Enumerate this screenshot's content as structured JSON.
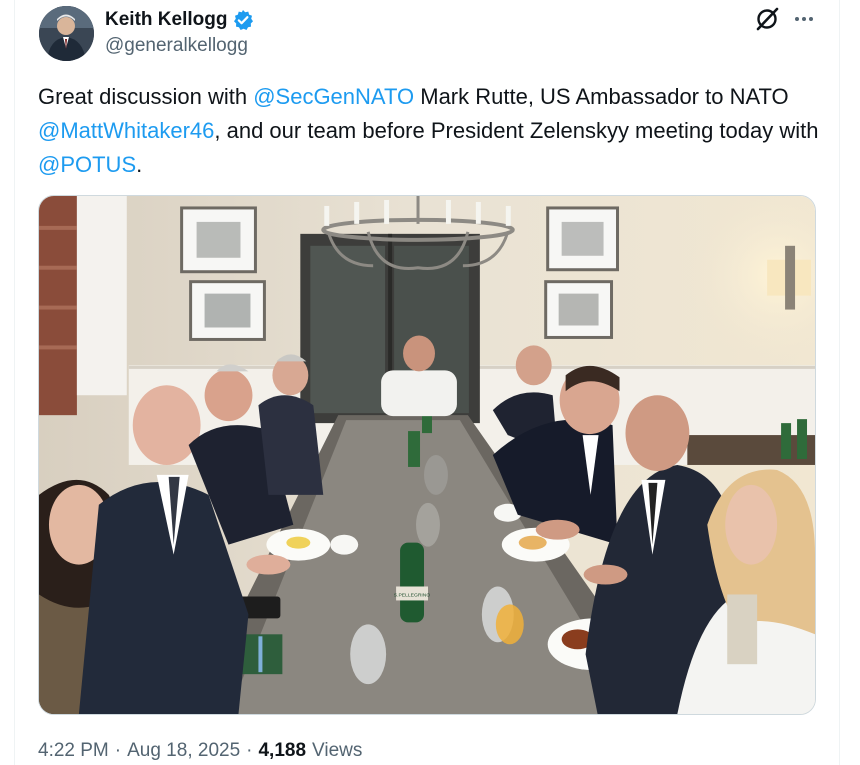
{
  "author": {
    "display_name": "Keith Kellogg",
    "handle": "@generalkellogg",
    "verified": true,
    "verified_color": "#1d9bf0",
    "avatar_icon": "profile-photo"
  },
  "header_icons": {
    "grok": "grok-icon",
    "more": "more-options-icon"
  },
  "tweet": {
    "text_1": "Great discussion with ",
    "mention_1": "@SecGenNATO",
    "text_2": " Mark Rutte, US Ambassador to NATO ",
    "mention_2": "@MattWhitaker46",
    "text_3": ", and our team before President Zelenskyy meeting today with ",
    "mention_3": "@POTUS",
    "text_4": "."
  },
  "media": {
    "type": "photo",
    "water_bottle_label": "S.PELLEGRINO"
  },
  "meta": {
    "time": "4:22 PM",
    "separator_1": "·",
    "date": "Aug 18, 2025",
    "separator_2": "·",
    "views_count": "4,188",
    "views_label": "Views"
  },
  "colors": {
    "link": "#1d9bf0",
    "secondary_text": "#536471",
    "primary_text": "#0f1419"
  }
}
